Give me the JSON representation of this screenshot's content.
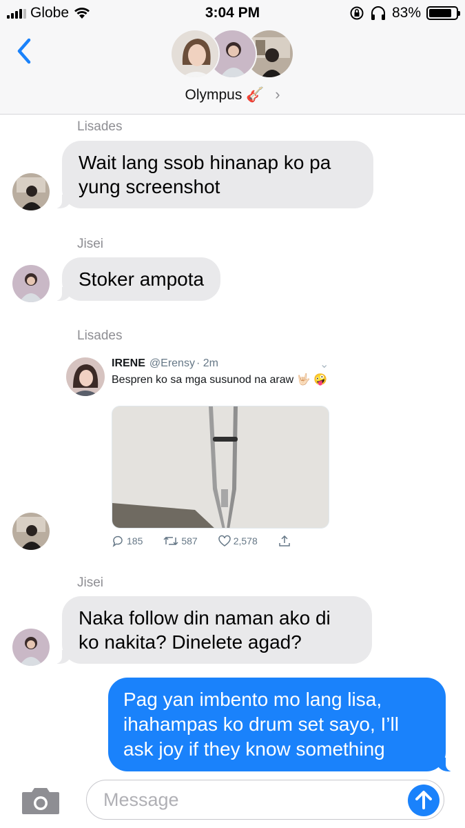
{
  "status_bar": {
    "carrier": "Globe",
    "time": "3:04 PM",
    "battery_percent": "83%",
    "battery_level": 0.83,
    "icons": [
      "signal-icon",
      "wifi-icon",
      "orientation-lock-icon",
      "headphones-icon",
      "battery-icon"
    ]
  },
  "header": {
    "group_name": "Olympus",
    "group_emoji": "🎸",
    "chevron": "›",
    "icons": [
      "back-chevron-icon",
      "group-avatar"
    ]
  },
  "messages": [
    {
      "sender": "Lisades",
      "text": "Wait lang ssob hinanap ko pa yung screenshot"
    },
    {
      "sender": "Jisei",
      "text": "Stoker ampota"
    },
    {
      "sender": "Lisades",
      "type": "tweet-screenshot"
    },
    {
      "sender": "Jisei",
      "text": "Naka follow din naman ako di ko nakita? Dinelete agad?"
    },
    {
      "sender": "me",
      "text": "Pag yan imbento mo lang lisa, ihahampas ko drum set sayo, I’ll ask joy if they know something"
    }
  ],
  "tweet": {
    "name": "IRENE",
    "handle": "@Erensy",
    "time": "· 2m",
    "caret": "⌄",
    "text": "Bespren ko sa mga susunod na araw 🤟🏻 🤪",
    "replies": "185",
    "retweets": "587",
    "likes": "2,578"
  },
  "composer": {
    "placeholder": "Message",
    "icons": [
      "camera-icon",
      "send-arrow-icon"
    ]
  },
  "colors": {
    "bubble_in": "#e9e9eb",
    "bubble_out": "#1a82fb",
    "header_bg": "#f7f7f8",
    "sender_label": "#8e8e93"
  }
}
